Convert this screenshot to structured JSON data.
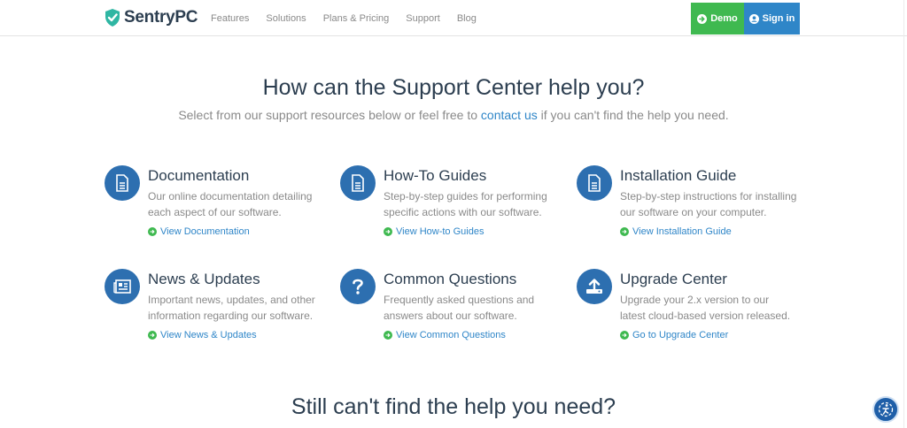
{
  "header": {
    "brand": "SentryPC",
    "nav": [
      "Features",
      "Solutions",
      "Plans & Pricing",
      "Support",
      "Blog"
    ],
    "demo_label": "Demo",
    "signin_label": "Sign in",
    "colors": {
      "demo": "#3fb950",
      "signin": "#2f86c8"
    }
  },
  "hero": {
    "title": "How can the Support Center help you?",
    "sub_before": "Select from our support resources below or feel free to ",
    "sub_link": "contact us",
    "sub_after": " if you can't find the help you need."
  },
  "cards": [
    {
      "icon": "document-icon",
      "title": "Documentation",
      "desc": "Our online documentation detailing each aspect of our software.",
      "link": "View Documentation"
    },
    {
      "icon": "document-icon",
      "title": "How-To Guides",
      "desc": "Step-by-step guides for performing specific actions with our software.",
      "link": "View How-to Guides"
    },
    {
      "icon": "document-icon",
      "title": "Installation Guide",
      "desc": "Step-by-step instructions for installing our software on your computer.",
      "link": "View Installation Guide"
    },
    {
      "icon": "newspaper-icon",
      "title": "News & Updates",
      "desc": "Important news, updates, and other information regarding our software.",
      "link": "View News & Updates"
    },
    {
      "icon": "question-icon",
      "title": "Common Questions",
      "desc": "Frequently asked questions and answers about our software.",
      "link": "View Common Questions"
    },
    {
      "icon": "upload-icon",
      "title": "Upgrade Center",
      "desc": "Upgrade your 2.x version to our latest cloud-based version released.",
      "link": "Go to Upgrade Center"
    }
  ],
  "bottom": {
    "title": "Still can't find the help you need?"
  }
}
